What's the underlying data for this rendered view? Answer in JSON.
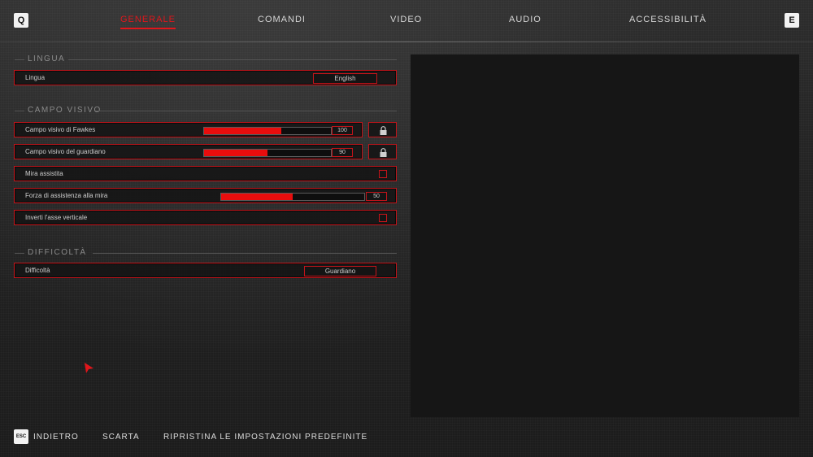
{
  "nav": {
    "left_key": "Q",
    "right_key": "E",
    "tabs": [
      {
        "label": "GENERALE",
        "active": true
      },
      {
        "label": "COMANDI",
        "active": false
      },
      {
        "label": "VIDEO",
        "active": false
      },
      {
        "label": "AUDIO",
        "active": false
      },
      {
        "label": "ACCESSIBILITÀ",
        "active": false
      }
    ]
  },
  "sections": {
    "lingua": {
      "title": "LINGUA",
      "language_label": "Lingua",
      "language_value": "English"
    },
    "campo_visivo": {
      "title": "CAMPO VISIVO",
      "fov_fawkes": {
        "label": "Campo visivo di Fawkes",
        "value": "100",
        "fill_fraction": 0.61
      },
      "fov_guardian": {
        "label": "Campo visivo del guardiano",
        "value": "90",
        "fill_fraction": 0.5
      },
      "aim_assist": {
        "label": "Mira assistita",
        "checked": false
      },
      "aim_assist_strength": {
        "label": "Forza di assistenza alla mira",
        "value": "50",
        "fill_fraction": 0.5
      },
      "invert_y": {
        "label": "Inverti l'asse verticale",
        "checked": false
      }
    },
    "difficolta": {
      "title": "DIFFICOLTÀ",
      "difficulty_label": "Difficoltà",
      "difficulty_value": "Guardiano"
    }
  },
  "bottom": {
    "esc_key": "ESC",
    "back_label": "INDIETRO",
    "discard_label": "SCARTA",
    "reset_label": "RIPRISTINA LE IMPOSTAZIONI PREDEFINITE"
  },
  "colors": {
    "accent": "#e0161b",
    "slider_fill": "#e80d0d",
    "background": "#222222",
    "panel": "#161616"
  },
  "icons": [
    "lock-icon",
    "cursor-arrow-icon"
  ]
}
